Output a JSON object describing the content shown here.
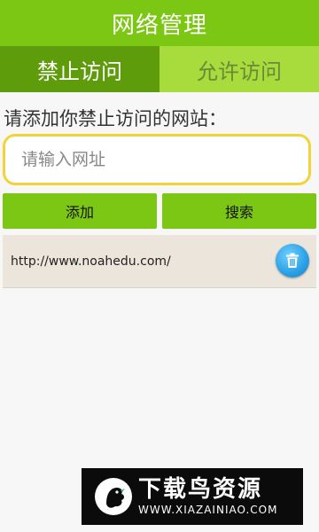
{
  "header": {
    "title": "网络管理"
  },
  "tabs": [
    {
      "label": "禁止访问",
      "active": true
    },
    {
      "label": "允许访问",
      "active": false
    }
  ],
  "form": {
    "prompt": "请添加你禁止访问的网站：",
    "input_placeholder": "请输入网址",
    "input_value": "",
    "add_label": "添加",
    "search_label": "搜索"
  },
  "blocked_sites": [
    {
      "url": "http://www.noahedu.com/",
      "action_icon": "trash-icon"
    }
  ],
  "watermark": {
    "title": "下载鸟资源",
    "url": "WWW.XIAZAINIAO.COM",
    "logo_icon": "bird-logo-icon"
  },
  "colors": {
    "primary_green": "#7cc614",
    "active_tab": "#5e9c0b",
    "inactive_tab": "#a8db3c",
    "input_border": "#f2d43a",
    "list_item_bg": "#ebe5dc",
    "delete_blue": "#2a9fe4"
  }
}
